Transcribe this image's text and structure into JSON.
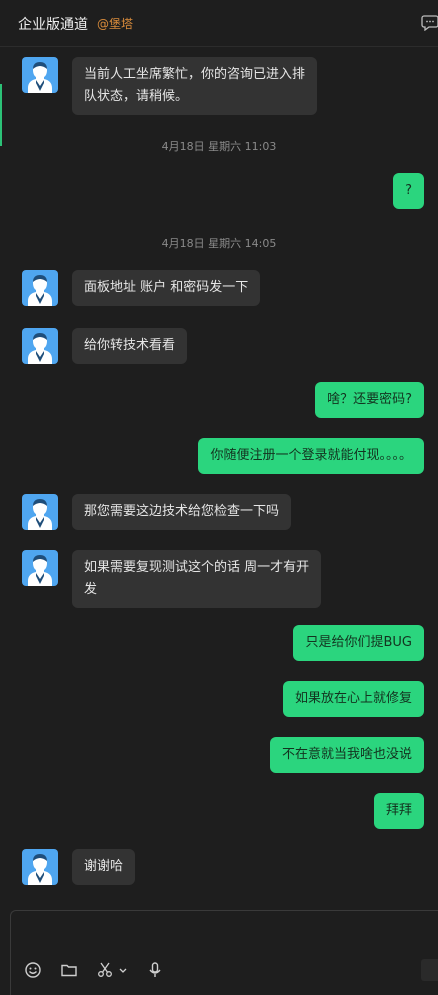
{
  "header": {
    "title": "企业版通道",
    "tag": "@堡塔"
  },
  "messages": [
    {
      "side": "in",
      "text": "当前人工坐席繁忙，你的咨询已进入排\n队状态，请稍候。"
    },
    {
      "time": "4月18日 星期六 11:03"
    },
    {
      "side": "out",
      "text": "?"
    },
    {
      "time": "4月18日 星期六 14:05"
    },
    {
      "side": "in",
      "text": "面板地址 账户 和密码发一下"
    },
    {
      "side": "in",
      "text": "给你转技术看看"
    },
    {
      "side": "out",
      "text": "啥？还要密码?"
    },
    {
      "side": "out",
      "text": "你随便注册一个登录就能付现。。。。"
    },
    {
      "side": "in",
      "text": "那您需要这边技术给您检查一下吗"
    },
    {
      "side": "in",
      "text": "如果需要复现测试这个的话 周一才有开\n发"
    },
    {
      "side": "out",
      "text": "只是给你们提BUG"
    },
    {
      "side": "out",
      "text": "如果放在心上就修复"
    },
    {
      "side": "out",
      "text": "不在意就当我啥也没说"
    },
    {
      "side": "out",
      "text": "拜拜"
    },
    {
      "side": "in",
      "text": "谢谢哈"
    }
  ],
  "composer": {
    "tools": [
      "emoji-icon",
      "folder-icon",
      "scissors-icon",
      "chevron-down-icon",
      "microphone-icon"
    ]
  },
  "colors": {
    "background": "#1e1e1e",
    "incoming_bubble": "#333333",
    "outgoing_bubble": "#2bd57e",
    "tag": "#d98b3b",
    "avatar": "#4fa6f0"
  }
}
